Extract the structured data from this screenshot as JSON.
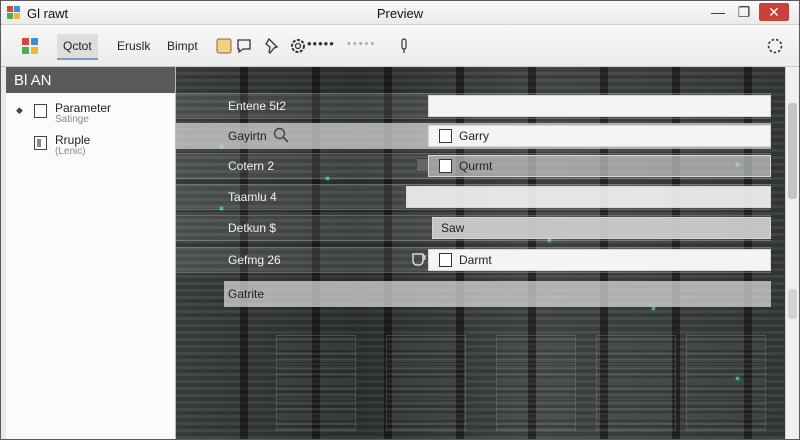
{
  "window": {
    "app_name": "Gl rawt",
    "title": "Preview",
    "minimize_label": "—",
    "maximize_label": "❐",
    "close_label": "✕"
  },
  "toolbar": {
    "tab_1": "Qctot",
    "tab_2": "Eruslk",
    "tab_3": "Bimpt",
    "dots_label": "•••••",
    "faint_dots_label": "•••••"
  },
  "left_panel": {
    "header": "Bl AN",
    "items": [
      {
        "label": "Parameter",
        "sublabel": "Satinge"
      },
      {
        "label": "Rruple",
        "sublabel": "(Lenic)"
      }
    ]
  },
  "rows": [
    {
      "label": "Entene 5t2",
      "field": ""
    },
    {
      "label": "Gayirtn",
      "field": "Garry",
      "checkbox": true
    },
    {
      "label": "Cotern 2",
      "field": "Qurmt",
      "checkbox": true
    },
    {
      "label": "Taamlu 4",
      "field": ""
    },
    {
      "label": "Detkun $",
      "field": "Saw"
    },
    {
      "label": "Gefmg 26",
      "field": "Darmt",
      "checkbox": true
    },
    {
      "label": "Gatrite",
      "field": ""
    }
  ],
  "colors": {
    "close_button": "#c8413a",
    "active_tab_underline": "#7a9cc6",
    "led_green": "#3fbf6a"
  },
  "icons": [
    "app-icon",
    "search-icon",
    "cup-icon",
    "settings-gear-icon",
    "pin-icon",
    "speech-bubble-icon",
    "probe-icon",
    "refresh-icon"
  ]
}
